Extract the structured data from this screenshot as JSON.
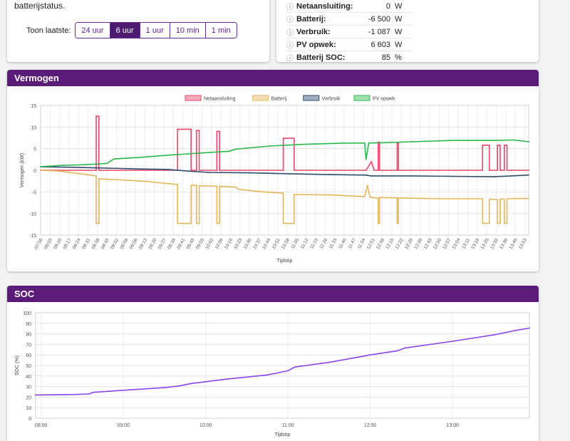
{
  "intro": {
    "text": "batterijstatus."
  },
  "range_selector": {
    "label": "Toon laatste:",
    "options": [
      "24 uur",
      "6 uur",
      "1 uur",
      "10 min",
      "1 min"
    ],
    "active": "6 uur"
  },
  "status": {
    "rows": [
      {
        "label": "Netaansluiting:",
        "value": "0",
        "unit": "W"
      },
      {
        "label": "Batterij:",
        "value": "-6 500",
        "unit": "W"
      },
      {
        "label": "Verbruik:",
        "value": "-1 087",
        "unit": "W"
      },
      {
        "label": "PV opwek:",
        "value": "6 603",
        "unit": "W"
      },
      {
        "label": "Batterij SOC:",
        "value": "85",
        "unit": "%"
      }
    ]
  },
  "power_panel": {
    "title": "Vermogen"
  },
  "soc_panel": {
    "title": "SOC"
  },
  "colors": {
    "netaansluiting": "#e8456b",
    "batterij": "#e5b75a",
    "verbruik": "#2f4b6e",
    "pv_opwek": "#2cb84e",
    "soc": "#8b45ef",
    "header": "#5a1c76"
  },
  "chart_data": [
    {
      "type": "line",
      "ylabel": "Vermogen (kW)",
      "xlabel": "Tijdstip",
      "ylim": [
        -15,
        15
      ],
      "yticks": [
        15,
        10,
        5,
        0,
        -5,
        -10,
        -15
      ],
      "grid": true,
      "legend_position": "top",
      "x_start": "07:56",
      "x_end": "13:56",
      "xticks": [
        "07:56",
        "08:03",
        "08:10",
        "08:17",
        "08:24",
        "08:31",
        "08:38",
        "08:45",
        "08:52",
        "08:59",
        "09:06",
        "09:13",
        "09:20",
        "09:27",
        "09:34",
        "09:41",
        "09:48",
        "09:55",
        "10:02",
        "10:09",
        "10:16",
        "10:23",
        "10:30",
        "10:37",
        "10:44",
        "10:51",
        "10:58",
        "11:05",
        "11:12",
        "11:19",
        "11:26",
        "11:33",
        "11:40",
        "11:47",
        "11:54",
        "12:01",
        "12:08",
        "12:15",
        "12:22",
        "12:29",
        "12:36",
        "12:43",
        "12:50",
        "12:57",
        "13:04",
        "13:11",
        "13:18",
        "13:25",
        "13:32",
        "13:39",
        "13:46",
        "13:53"
      ],
      "series": [
        {
          "name": "Netaansluiting",
          "color": "#e8456b",
          "points": [
            [
              "07:56",
              0
            ],
            [
              "08:37",
              0
            ],
            [
              "08:37",
              12.5
            ],
            [
              "08:39",
              12.5
            ],
            [
              "08:39",
              0
            ],
            [
              "09:37",
              0
            ],
            [
              "09:37",
              9.5
            ],
            [
              "09:47",
              9.5
            ],
            [
              "09:47",
              0
            ],
            [
              "09:51",
              0
            ],
            [
              "09:51",
              9.2
            ],
            [
              "09:53",
              9.2
            ],
            [
              "09:53",
              0
            ],
            [
              "10:06",
              0
            ],
            [
              "10:06",
              9.0
            ],
            [
              "10:08",
              9.0
            ],
            [
              "10:08",
              0
            ],
            [
              "10:55",
              0
            ],
            [
              "10:55",
              7.4
            ],
            [
              "11:03",
              7.4
            ],
            [
              "11:03",
              0
            ],
            [
              "11:56",
              0
            ],
            [
              "12:00",
              2.0
            ],
            [
              "12:02",
              0
            ],
            [
              "12:05",
              0
            ],
            [
              "12:05",
              6.5
            ],
            [
              "12:06",
              6.5
            ],
            [
              "12:06",
              0
            ],
            [
              "12:19",
              0
            ],
            [
              "12:19",
              6.3
            ],
            [
              "12:20",
              6.3
            ],
            [
              "12:20",
              0
            ],
            [
              "13:22",
              0
            ],
            [
              "13:22",
              5.8
            ],
            [
              "13:27",
              5.8
            ],
            [
              "13:27",
              0
            ],
            [
              "13:33",
              0
            ],
            [
              "13:33",
              5.8
            ],
            [
              "13:35",
              5.8
            ],
            [
              "13:35",
              0
            ],
            [
              "13:38",
              0
            ],
            [
              "13:38",
              5.8
            ],
            [
              "13:40",
              5.8
            ],
            [
              "13:40",
              0
            ],
            [
              "13:56",
              0
            ]
          ]
        },
        {
          "name": "Batterij",
          "color": "#e5b75a",
          "points": [
            [
              "07:56",
              0
            ],
            [
              "08:10",
              -0.2
            ],
            [
              "08:30",
              -1.0
            ],
            [
              "08:37",
              -1.3
            ],
            [
              "08:37",
              -12.3
            ],
            [
              "08:39",
              -12.3
            ],
            [
              "08:39",
              -2.0
            ],
            [
              "09:00",
              -2.3
            ],
            [
              "09:15",
              -2.6
            ],
            [
              "09:37",
              -3.3
            ],
            [
              "09:37",
              -12.3
            ],
            [
              "09:47",
              -12.3
            ],
            [
              "09:47",
              -3.5
            ],
            [
              "09:51",
              -3.5
            ],
            [
              "09:51",
              -12.3
            ],
            [
              "09:53",
              -12.3
            ],
            [
              "09:53",
              -3.6
            ],
            [
              "10:06",
              -3.7
            ],
            [
              "10:06",
              -12.3
            ],
            [
              "10:08",
              -12.3
            ],
            [
              "10:08",
              -3.7
            ],
            [
              "10:20",
              -3.9
            ],
            [
              "10:22",
              -4.4
            ],
            [
              "10:40",
              -5.0
            ],
            [
              "10:55",
              -5.3
            ],
            [
              "10:55",
              -12.3
            ],
            [
              "11:03",
              -12.3
            ],
            [
              "11:03",
              -5.6
            ],
            [
              "11:30",
              -5.7
            ],
            [
              "11:55",
              -6.1
            ],
            [
              "11:57",
              -3.5
            ],
            [
              "11:59",
              -6.2
            ],
            [
              "12:05",
              -6.5
            ],
            [
              "12:05",
              -12.3
            ],
            [
              "12:06",
              -12.3
            ],
            [
              "12:06",
              -6.3
            ],
            [
              "12:19",
              -6.4
            ],
            [
              "12:19",
              -12.3
            ],
            [
              "12:20",
              -12.3
            ],
            [
              "12:20",
              -6.4
            ],
            [
              "12:50",
              -6.6
            ],
            [
              "13:22",
              -6.6
            ],
            [
              "13:22",
              -12.3
            ],
            [
              "13:27",
              -12.3
            ],
            [
              "13:27",
              -6.7
            ],
            [
              "13:33",
              -6.8
            ],
            [
              "13:33",
              -12.3
            ],
            [
              "13:35",
              -12.3
            ],
            [
              "13:35",
              -6.7
            ],
            [
              "13:38",
              -6.7
            ],
            [
              "13:38",
              -12.3
            ],
            [
              "13:40",
              -12.3
            ],
            [
              "13:40",
              -6.6
            ],
            [
              "13:56",
              -6.5
            ]
          ]
        },
        {
          "name": "Verbruik",
          "color": "#2f4b6e",
          "points": [
            [
              "07:56",
              0.8
            ],
            [
              "08:20",
              0.7
            ],
            [
              "08:45",
              0.5
            ],
            [
              "09:10",
              0.3
            ],
            [
              "09:30",
              0.2
            ],
            [
              "09:45",
              -0.2
            ],
            [
              "10:00",
              -0.5
            ],
            [
              "10:30",
              -0.6
            ],
            [
              "11:00",
              -0.8
            ],
            [
              "11:30",
              -1.0
            ],
            [
              "11:55",
              -1.1
            ],
            [
              "12:00",
              -1.3
            ],
            [
              "12:30",
              -1.3
            ],
            [
              "13:00",
              -1.4
            ],
            [
              "13:30",
              -1.5
            ],
            [
              "13:50",
              -1.2
            ],
            [
              "13:56",
              -1.1
            ]
          ]
        },
        {
          "name": "PV opwek",
          "color": "#2cb84e",
          "points": [
            [
              "07:56",
              0.8
            ],
            [
              "08:10",
              1.1
            ],
            [
              "08:30",
              1.3
            ],
            [
              "08:45",
              1.6
            ],
            [
              "08:50",
              2.6
            ],
            [
              "09:10",
              3.0
            ],
            [
              "09:30",
              3.5
            ],
            [
              "10:00",
              4.1
            ],
            [
              "10:15",
              4.4
            ],
            [
              "10:20",
              4.9
            ],
            [
              "10:45",
              5.6
            ],
            [
              "11:10",
              6.0
            ],
            [
              "11:30",
              6.2
            ],
            [
              "11:40",
              6.3
            ],
            [
              "11:55",
              6.3
            ],
            [
              "11:56",
              2.5
            ],
            [
              "11:58",
              6.3
            ],
            [
              "12:10",
              6.4
            ],
            [
              "12:30",
              6.6
            ],
            [
              "13:00",
              6.9
            ],
            [
              "13:30",
              6.9
            ],
            [
              "13:45",
              7.0
            ],
            [
              "13:56",
              6.6
            ]
          ]
        }
      ]
    },
    {
      "type": "line",
      "ylabel": "SOC (%)",
      "xlabel": "Tijdstip",
      "ylim": [
        0,
        100
      ],
      "yticks": [
        100,
        90,
        80,
        70,
        60,
        50,
        40,
        30,
        20,
        10,
        0
      ],
      "grid": true,
      "xticks": [
        "08:00",
        "09:00",
        "10:00",
        "11:00",
        "12:00",
        "13:00"
      ],
      "x_start": "07:56",
      "x_end": "13:56",
      "series": [
        {
          "name": "SOC",
          "color": "#8b45ef",
          "points": [
            [
              "07:56",
              22
            ],
            [
              "08:25",
              22.5
            ],
            [
              "08:35",
              23
            ],
            [
              "08:38",
              24.5
            ],
            [
              "09:00",
              26.5
            ],
            [
              "09:30",
              29
            ],
            [
              "09:40",
              30.5
            ],
            [
              "09:50",
              33
            ],
            [
              "10:15",
              37
            ],
            [
              "10:45",
              41
            ],
            [
              "11:00",
              45
            ],
            [
              "11:05",
              48.5
            ],
            [
              "11:30",
              53
            ],
            [
              "12:00",
              60
            ],
            [
              "12:20",
              64
            ],
            [
              "12:25",
              66.5
            ],
            [
              "13:00",
              73
            ],
            [
              "13:30",
              79
            ],
            [
              "13:45",
              83
            ],
            [
              "13:56",
              85.5
            ]
          ]
        }
      ]
    }
  ]
}
